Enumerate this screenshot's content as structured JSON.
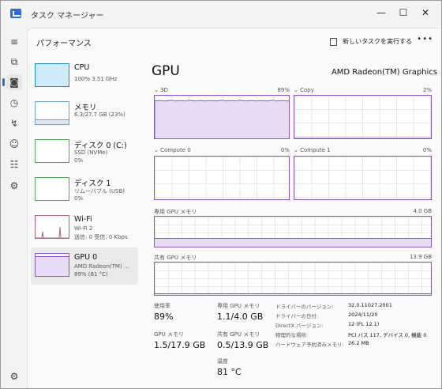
{
  "window": {
    "title": "タスク マネージャー",
    "minimize": "—",
    "maximize": "☐",
    "close": "✕"
  },
  "rail": {
    "items": [
      {
        "name": "hamburger-menu-icon",
        "glyph": "≡"
      },
      {
        "name": "processes-icon",
        "glyph": "⧉"
      },
      {
        "name": "performance-icon",
        "glyph": "◙"
      },
      {
        "name": "app-history-icon",
        "glyph": "◷"
      },
      {
        "name": "startup-apps-icon",
        "glyph": "↯"
      },
      {
        "name": "users-icon",
        "glyph": "☺"
      },
      {
        "name": "details-icon",
        "glyph": "☷"
      },
      {
        "name": "services-icon",
        "glyph": "⚙"
      },
      {
        "name": "settings-icon",
        "glyph": "⚙"
      }
    ]
  },
  "header": {
    "title": "パフォーマンス",
    "run_task": "新しいタスクを実行する",
    "more": "•••"
  },
  "sidebar": {
    "items": [
      {
        "name": "CPU",
        "line1": "100%  3.51 GHz",
        "line2": "",
        "line3": ""
      },
      {
        "name": "メモリ",
        "line1": "6.3/27.7 GB (23%)",
        "line2": "",
        "line3": ""
      },
      {
        "name": "ディスク 0 (C:)",
        "line1": "SSD (NVMe)",
        "line2": "0%",
        "line3": ""
      },
      {
        "name": "ディスク 1",
        "line1": "リムーバブル (USB)",
        "line2": "0%",
        "line3": ""
      },
      {
        "name": "Wi-Fi",
        "line1": "Wi-Fi 2",
        "line2": "送信: 0  受信: 0 Kbps",
        "line3": ""
      },
      {
        "name": "GPU 0",
        "line1": "AMD Radeon(TM) ...",
        "line2": "89%  (81 °C)",
        "line3": ""
      }
    ],
    "cpu_usage": 1.0,
    "memory_usage": 0.23,
    "gpu_usage": 0.89
  },
  "detail": {
    "title": "GPU",
    "model": "AMD Radeon(TM) Graphics",
    "engines": [
      {
        "label": "3D",
        "pct": "89%",
        "usage": 0.89
      },
      {
        "label": "Copy",
        "pct": "2%",
        "usage": 0.02
      },
      {
        "label": "Compute 0",
        "pct": "0%",
        "usage": 0.0
      },
      {
        "label": "Compute 1",
        "pct": "0%",
        "usage": 0.0
      }
    ],
    "dedicated": {
      "label": "専用 GPU メモリ",
      "max": "4.0 GB"
    },
    "shared": {
      "label": "共有 GPU メモリ",
      "max": "13.9 GB"
    },
    "stats": {
      "usage_label": "使用率",
      "usage_value": "89%",
      "gpu_mem_label": "GPU メモリ",
      "gpu_mem_value": "1.5/17.9 GB",
      "dedicated_label": "専用 GPU メモリ",
      "dedicated_value": "1.1/4.0 GB",
      "shared_label": "共有 GPU メモリ",
      "shared_value": "0.5/13.9 GB",
      "temp_label": "温度",
      "temp_value": "81 °C"
    },
    "info": [
      {
        "key": "ドライバーのバージョン:",
        "value": "32.0.11027.2001"
      },
      {
        "key": "ドライバーの日付:",
        "value": "2024/11/20"
      },
      {
        "key": "DirectX バージョン:",
        "value": "12 (FL 12.1)"
      },
      {
        "key": "物理的な場所:",
        "value": "PCI バス 117, デバイス 0, 機能 0"
      },
      {
        "key": "ハードウェア予約済みメモリ:",
        "value": "26.2 MB"
      }
    ]
  },
  "colors": {
    "gpu": "#8b55c9",
    "gpu_fill": "#e8dbf6",
    "cpu": "#1f8ccf",
    "cpu_fill": "#cfeaf8",
    "memory": "#6a9fd2",
    "disk": "#4fa35c",
    "wifi": "#b45e7b",
    "accent": "#2a6dd6"
  }
}
